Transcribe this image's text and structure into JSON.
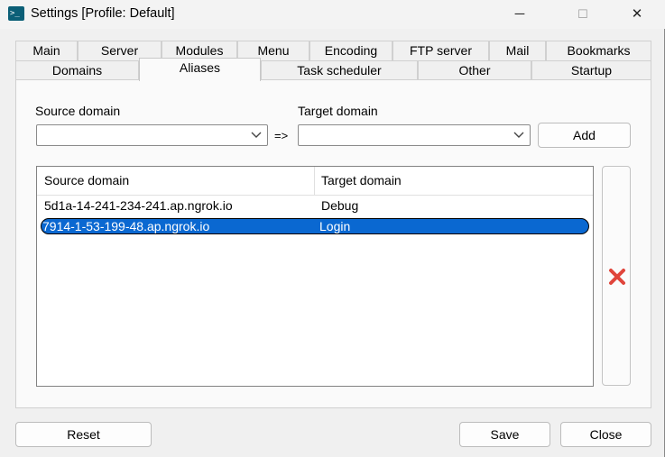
{
  "window": {
    "title": "Settings [Profile: Default]",
    "icon": "terminal-icon",
    "controls": {
      "minimize": "─",
      "maximize": "☐",
      "close": "✕"
    }
  },
  "tabs": {
    "row1": [
      "Main",
      "Server",
      "Modules",
      "Menu",
      "Encoding",
      "FTP server",
      "Mail",
      "Bookmarks"
    ],
    "row2": [
      "Domains",
      "Aliases",
      "Task scheduler",
      "Other",
      "Startup"
    ],
    "active": "Aliases"
  },
  "form": {
    "source_label": "Source domain",
    "target_label": "Target domain",
    "source_value": "",
    "target_value": "",
    "arrow": "=>",
    "add_label": "Add"
  },
  "table": {
    "columns": [
      "Source domain",
      "Target domain"
    ],
    "rows": [
      {
        "source": "5d1a-14-241-234-241.ap.ngrok.io",
        "target": "Debug",
        "selected": false
      },
      {
        "source": "7914-1-53-199-48.ap.ngrok.io",
        "target": "Login",
        "selected": true
      }
    ]
  },
  "delete_icon": "red-x-icon",
  "footer": {
    "reset_label": "Reset",
    "save_label": "Save",
    "close_label": "Close"
  },
  "colors": {
    "selection": "#0a68d1",
    "delete": "#e0453b"
  }
}
